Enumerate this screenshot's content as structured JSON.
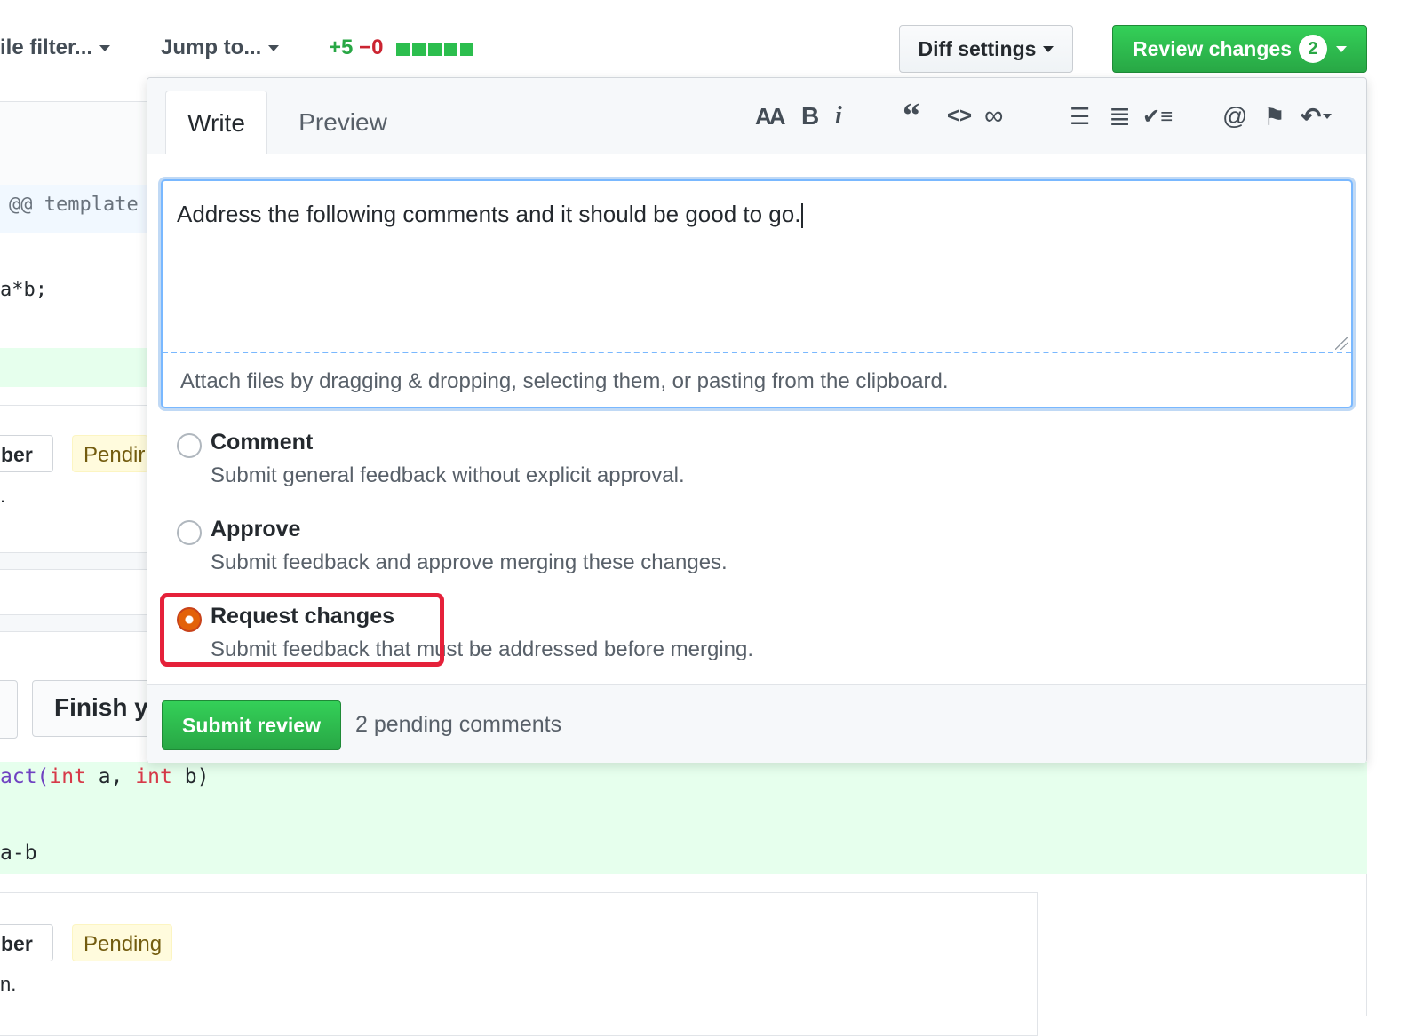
{
  "topbar": {
    "file_filter": "ile filter...",
    "jump_to": "Jump to...",
    "diffstat_add": "+5",
    "diffstat_del": "−0",
    "diff_settings": "Diff settings",
    "review_changes": "Review changes",
    "review_count": "2"
  },
  "background": {
    "hunk_header": "@@ template",
    "code_line_1": "a*b;",
    "author_1": "ber",
    "pending_1": "Pendir",
    "finish_button": "Finish y",
    "code_line_2_prefix": "act(",
    "code_line_2_kw1": "int",
    "code_line_2_mid": " a, ",
    "code_line_2_kw2": "int",
    "code_line_2_suffix": " b)",
    "code_line_3": "a-b",
    "author_2": "ber",
    "pending_2": "Pending",
    "dot_1": ".",
    "dot_2": "n."
  },
  "review": {
    "tabs": [
      "Write",
      "Preview"
    ],
    "toolbar": {
      "header": "AA",
      "bold": "B",
      "italic": "i",
      "quote": "“",
      "code": "<>",
      "link": "∞",
      "bullet_list": "☰",
      "numbered_list": "≣",
      "task_list": "✔≡",
      "mention": "@",
      "saved_reply": "⚑",
      "reply": "↶"
    },
    "body_text": "Address the following comments and it should be good to go.",
    "attach_hint": "Attach files by dragging & dropping, selecting them, or pasting from the clipboard.",
    "options": [
      {
        "title": "Comment",
        "desc": "Submit general feedback without explicit approval.",
        "checked": false
      },
      {
        "title": "Approve",
        "desc": "Submit feedback and approve merging these changes.",
        "checked": false
      },
      {
        "title": "Request changes",
        "desc": "Submit feedback that must be addressed before merging.",
        "checked": true
      }
    ],
    "submit_label": "Submit review",
    "pending_text": "2 pending comments"
  },
  "colors": {
    "accent_green": "#28a745",
    "highlight_red": "#e5213a",
    "focus_blue": "#79b8ff"
  }
}
